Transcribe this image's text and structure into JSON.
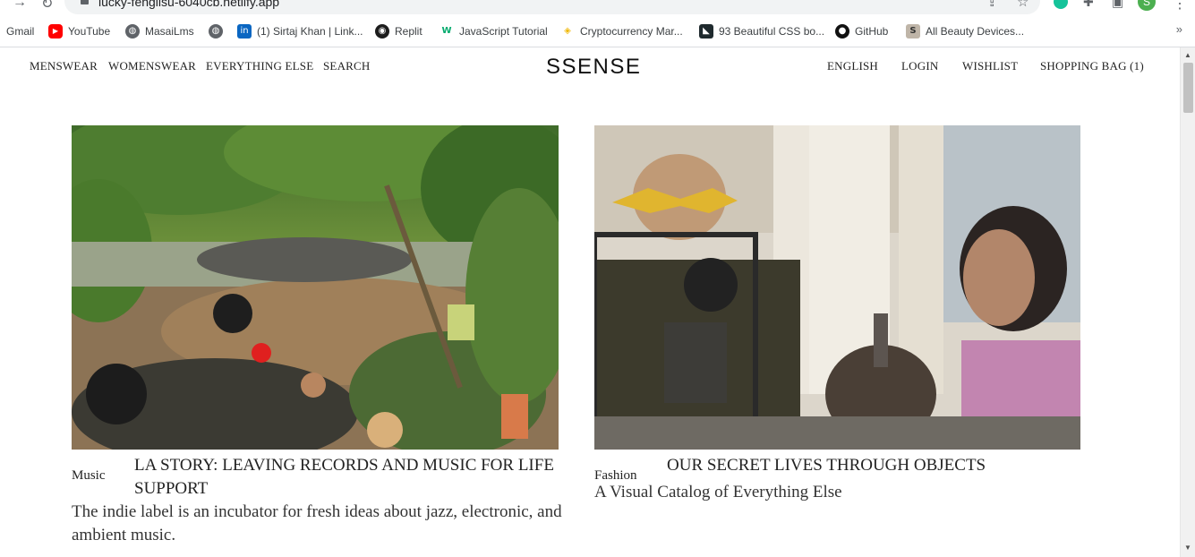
{
  "browser": {
    "url": "lucky-fenglisu-6040cb.netlify.app",
    "bookmarks": [
      {
        "label": "Gmail",
        "icon": "gmail-icon"
      },
      {
        "label": "YouTube",
        "icon": "youtube-icon"
      },
      {
        "label": "MasaiLms",
        "icon": "globe-icon"
      },
      {
        "label": "",
        "icon": "globe-icon"
      },
      {
        "label": "(1) Sirtaj Khan | Link...",
        "icon": "linkedin-icon"
      },
      {
        "label": "Replit",
        "icon": "replit-icon"
      },
      {
        "label": "JavaScript Tutorial",
        "icon": "w3-icon"
      },
      {
        "label": "Cryptocurrency Mar...",
        "icon": "binance-icon"
      },
      {
        "label": "93 Beautiful CSS bo...",
        "icon": "css-icon"
      },
      {
        "label": "GitHub",
        "icon": "github-icon"
      },
      {
        "label": "All Beauty Devices...",
        "icon": "s-icon"
      }
    ],
    "more_symbol": "»",
    "profile_initial": "S"
  },
  "nav": {
    "left": [
      "MENSWEAR",
      "WOMENSWEAR",
      "EVERYTHING ELSE",
      "SEARCH"
    ],
    "logo": "SSENSE",
    "right": [
      "ENGLISH",
      "LOGIN",
      "WISHLIST",
      "SHOPPING BAG (1)"
    ]
  },
  "articles": [
    {
      "category": "Music",
      "title": "LA STORY: LEAVING RECORDS AND MUSIC FOR LIFE SUPPORT",
      "description": "The indie label is an incubator for fresh ideas about jazz, electronic, and ambient music."
    },
    {
      "category": "Fashion",
      "title": "OUR SECRET LIVES THROUGH OBJECTS",
      "description": "A Visual Catalog of Everything Else"
    }
  ]
}
